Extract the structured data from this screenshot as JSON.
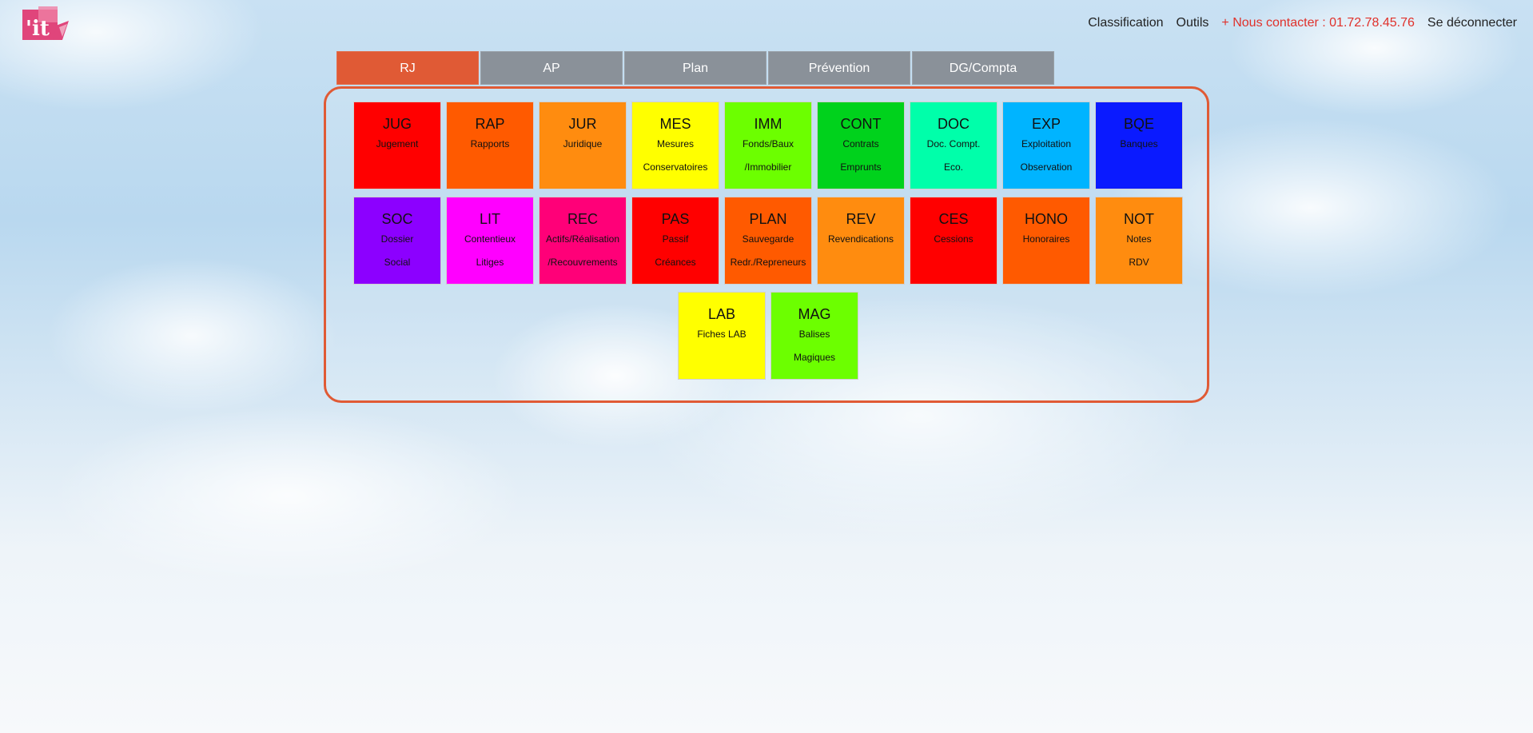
{
  "header": {
    "logo_text": "'it",
    "nav": [
      {
        "label": "Classification"
      },
      {
        "label": "Outils"
      },
      {
        "label": "+ Nous contacter : 01.72.78.45.76"
      },
      {
        "label": "Se déconnecter"
      }
    ]
  },
  "tabs": [
    {
      "label": "RJ",
      "active": true
    },
    {
      "label": "AP"
    },
    {
      "label": "Plan"
    },
    {
      "label": "Prévention"
    },
    {
      "label": "DG/Compta"
    }
  ],
  "tiles": [
    {
      "code": "JUG",
      "line1": "Jugement",
      "line2": "",
      "color": "#ff0000"
    },
    {
      "code": "RAP",
      "line1": "Rapports",
      "line2": "",
      "color": "#ff5a00"
    },
    {
      "code": "JUR",
      "line1": "Juridique",
      "line2": "",
      "color": "#ff8c0f"
    },
    {
      "code": "MES",
      "line1": "Mesures",
      "line2": "Conservatoires",
      "color": "#ffff00"
    },
    {
      "code": "IMM",
      "line1": "Fonds/Baux",
      "line2": "/Immobilier",
      "color": "#6cff00"
    },
    {
      "code": "CONT",
      "line1": "Contrats",
      "line2": "Emprunts",
      "color": "#00d21c"
    },
    {
      "code": "DOC",
      "line1": "Doc. Compt.",
      "line2": "Eco.",
      "color": "#00ffaa"
    },
    {
      "code": "EXP",
      "line1": "Exploitation",
      "line2": "Observation",
      "color": "#00b4ff"
    },
    {
      "code": "BQE",
      "line1": "Banques",
      "line2": "",
      "color": "#0a1aff"
    },
    {
      "code": "SOC",
      "line1": "Dossier",
      "line2": "Social",
      "color": "#8c00ff"
    },
    {
      "code": "LIT",
      "line1": "Contentieux",
      "line2": "Litiges",
      "color": "#ff00ff"
    },
    {
      "code": "REC",
      "line1": "Actifs/Réalisation",
      "line2": "/Recouvrements",
      "color": "#ff0078"
    },
    {
      "code": "PAS",
      "line1": "Passif",
      "line2": "Créances",
      "color": "#ff0000"
    },
    {
      "code": "PLAN",
      "line1": "Sauvegarde",
      "line2": "Redr./Repreneurs",
      "color": "#ff5a00"
    },
    {
      "code": "REV",
      "line1": "Revendications",
      "line2": "",
      "color": "#ff8c0f"
    },
    {
      "code": "CES",
      "line1": "Cessions",
      "line2": "",
      "color": "#ff0000"
    },
    {
      "code": "HONO",
      "line1": "Honoraires",
      "line2": "",
      "color": "#ff5a00"
    },
    {
      "code": "NOT",
      "line1": "Notes",
      "line2": "RDV",
      "color": "#ff8c0f"
    },
    {
      "code": "LAB",
      "line1": "Fiches LAB",
      "line2": "",
      "color": "#ffff00"
    },
    {
      "code": "MAG",
      "line1": "Balises",
      "line2": "Magiques",
      "color": "#6cff00"
    }
  ]
}
